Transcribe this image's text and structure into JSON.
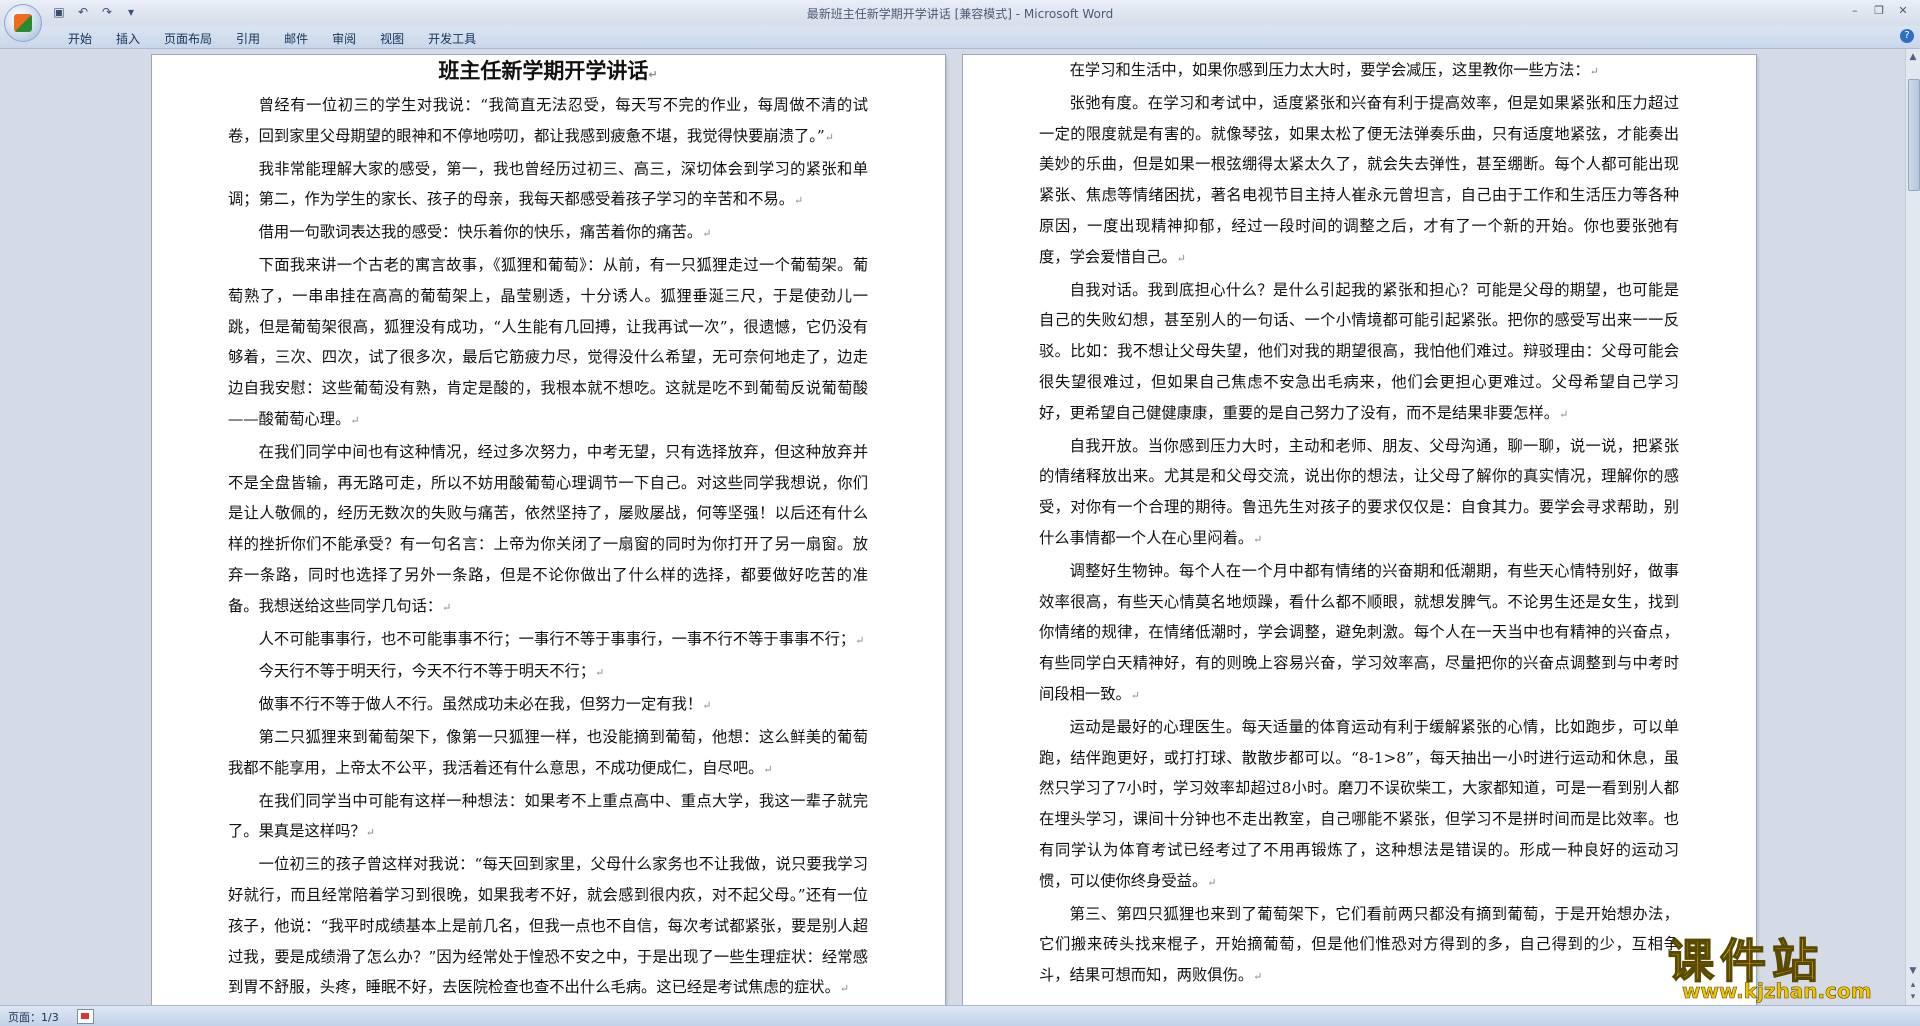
{
  "app": {
    "title": "最新班主任新学期开学讲话 [兼容模式] - Microsoft Word",
    "quick_access": [
      "save-icon",
      "undo-icon",
      "redo-icon",
      "customize-icon"
    ],
    "window_controls": [
      "minimize-icon",
      "restore-icon",
      "close-icon"
    ]
  },
  "ribbon": {
    "tabs": [
      "开始",
      "插入",
      "页面布局",
      "引用",
      "邮件",
      "审阅",
      "视图",
      "开发工具"
    ]
  },
  "document": {
    "left_page": {
      "heading": "班主任新学期开学讲话",
      "paragraphs": [
        "曾经有一位初三的学生对我说：“我简直无法忍受，每天写不完的作业，每周做不清的试卷，回到家里父母期望的眼神和不停地唠叨，都让我感到疲惫不堪，我觉得快要崩溃了。”",
        "我非常能理解大家的感受，第一，我也曾经历过初三、高三，深切体会到学习的紧张和单调；第二，作为学生的家长、孩子的母亲，我每天都感受着孩子学习的辛苦和不易。",
        "借用一句歌词表达我的感受：快乐着你的快乐，痛苦着你的痛苦。",
        "下面我来讲一个古老的寓言故事，《狐狸和葡萄》：从前，有一只狐狸走过一个葡萄架。葡萄熟了，一串串挂在高高的葡萄架上，晶莹剔透，十分诱人。狐狸垂涎三尺，于是使劲儿一跳，但是葡萄架很高，狐狸没有成功，“人生能有几回搏，让我再试一次”，很遗憾，它仍没有够着，三次、四次，试了很多次，最后它筋疲力尽，觉得没什么希望，无可奈何地走了，边走边自我安慰：这些葡萄没有熟，肯定是酸的，我根本就不想吃。这就是吃不到葡萄反说葡萄酸——酸葡萄心理。",
        "在我们同学中间也有这种情况，经过多次努力，中考无望，只有选择放弃，但这种放弃并不是全盘皆输，再无路可走，所以不妨用酸葡萄心理调节一下自己。对这些同学我想说，你们是让人敬佩的，经历无数次的失败与痛苦，依然坚持了，屡败屡战，何等坚强！以后还有什么样的挫折你们不能承受？有一句名言：上帝为你关闭了一扇窗的同时为你打开了另一扇窗。放弃一条路，同时也选择了另外一条路，但是不论你做出了什么样的选择，都要做好吃苦的准备。我想送给这些同学几句话：",
        "人不可能事事行，也不可能事事不行；一事行不等于事事行，一事不行不等于事事不行；",
        "今天行不等于明天行，今天不行不等于明天不行；",
        "做事不行不等于做人不行。虽然成功未必在我，但努力一定有我！",
        "第二只狐狸来到葡萄架下，像第一只狐狸一样，也没能摘到葡萄，他想：这么鲜美的葡萄我都不能享用，上帝太不公平，我活着还有什么意思，不成功便成仁，自尽吧。",
        "在我们同学当中可能有这样一种想法：如果考不上重点高中、重点大学，我这一辈子就完了。果真是这样吗？",
        "一位初三的孩子曾这样对我说：“每天回到家里，父母什么家务也不让我做，说只要我学习好就行，而且经常陪着学习到很晚，如果我考不好，就会感到很内疚，对不起父母。”还有一位孩子，他说：“我平时成绩基本上是前几名，但我一点也不自信，每次考试都紧张，要是别人超过我，要是成绩滑了怎么办？”因为经常处于惶恐不安之中，于是出现了一些生理症状：经常感到胃不舒服，头疼，睡眠不好，去医院检查也查不出什么毛病。这已经是考试焦虑的症状。"
      ]
    },
    "right_page": {
      "paragraphs": [
        "在学习和生活中，如果你感到压力太大时，要学会减压，这里教你一些方法：",
        "张弛有度。在学习和考试中，适度紧张和兴奋有利于提高效率，但是如果紧张和压力超过一定的限度就是有害的。就像琴弦，如果太松了便无法弹奏乐曲，只有适度地紧弦，才能奏出美妙的乐曲，但是如果一根弦绷得太紧太久了，就会失去弹性，甚至绷断。每个人都可能出现紧张、焦虑等情绪困扰，著名电视节目主持人崔永元曾坦言，自己由于工作和生活压力等各种原因，一度出现精神抑郁，经过一段时间的调整之后，才有了一个新的开始。你也要张弛有度，学会爱惜自己。",
        "自我对话。我到底担心什么？是什么引起我的紧张和担心？可能是父母的期望，也可能是自己的失败幻想，甚至别人的一句话、一个小情境都可能引起紧张。把你的感受写出来一一反驳。比如：我不想让父母失望，他们对我的期望很高，我怕他们难过。辩驳理由：父母可能会很失望很难过，但如果自己焦虑不安急出毛病来，他们会更担心更难过。父母希望自己学习好，更希望自己健健康康，重要的是自己努力了没有，而不是结果非要怎样。",
        "自我开放。当你感到压力大时，主动和老师、朋友、父母沟通，聊一聊，说一说，把紧张的情绪释放出来。尤其是和父母交流，说出你的想法，让父母了解你的真实情况，理解你的感受，对你有一个合理的期待。鲁迅先生对孩子的要求仅仅是：自食其力。要学会寻求帮助，别什么事情都一个人在心里闷着。",
        "调整好生物钟。每个人在一个月中都有情绪的兴奋期和低潮期，有些天心情特别好，做事效率很高，有些天心情莫名地烦躁，看什么都不顺眼，就想发脾气。不论男生还是女生，找到你情绪的规律，在情绪低潮时，学会调整，避免刺激。每个人在一天当中也有精神的兴奋点，有些同学白天精神好，有的则晚上容易兴奋，学习效率高，尽量把你的兴奋点调整到与中考时间段相一致。",
        "运动是最好的心理医生。每天适量的体育运动有利于缓解紧张的心情，比如跑步，可以单跑，结伴跑更好，或打打球、散散步都可以。“8-1>8”，每天抽出一小时进行运动和休息，虽然只学习了7小时，学习效率却超过8小时。磨刀不误砍柴工，大家都知道，可是一看到别人都在埋头学习，课间十分钟也不走出教室，自己哪能不紧张，但学习不是拼时间而是比效率。也有同学认为体育考试已经考过了不用再锻炼了，这种想法是错误的。形成一种良好的运动习惯，可以使你终身受益。",
        "第三、第四只狐狸也来到了葡萄架下，它们看前两只都没有摘到葡萄，于是开始想办法，它们搬来砖头找来棍子，开始摘葡萄，但是他们惟恐对方得到的多，自己得到的少，互相争斗，结果可想而知，两败俱伤。"
      ]
    }
  },
  "statusbar": {
    "page_info": "页面：1/3"
  },
  "watermark": {
    "text": "课件站",
    "url": "www.kjzhan.com"
  }
}
